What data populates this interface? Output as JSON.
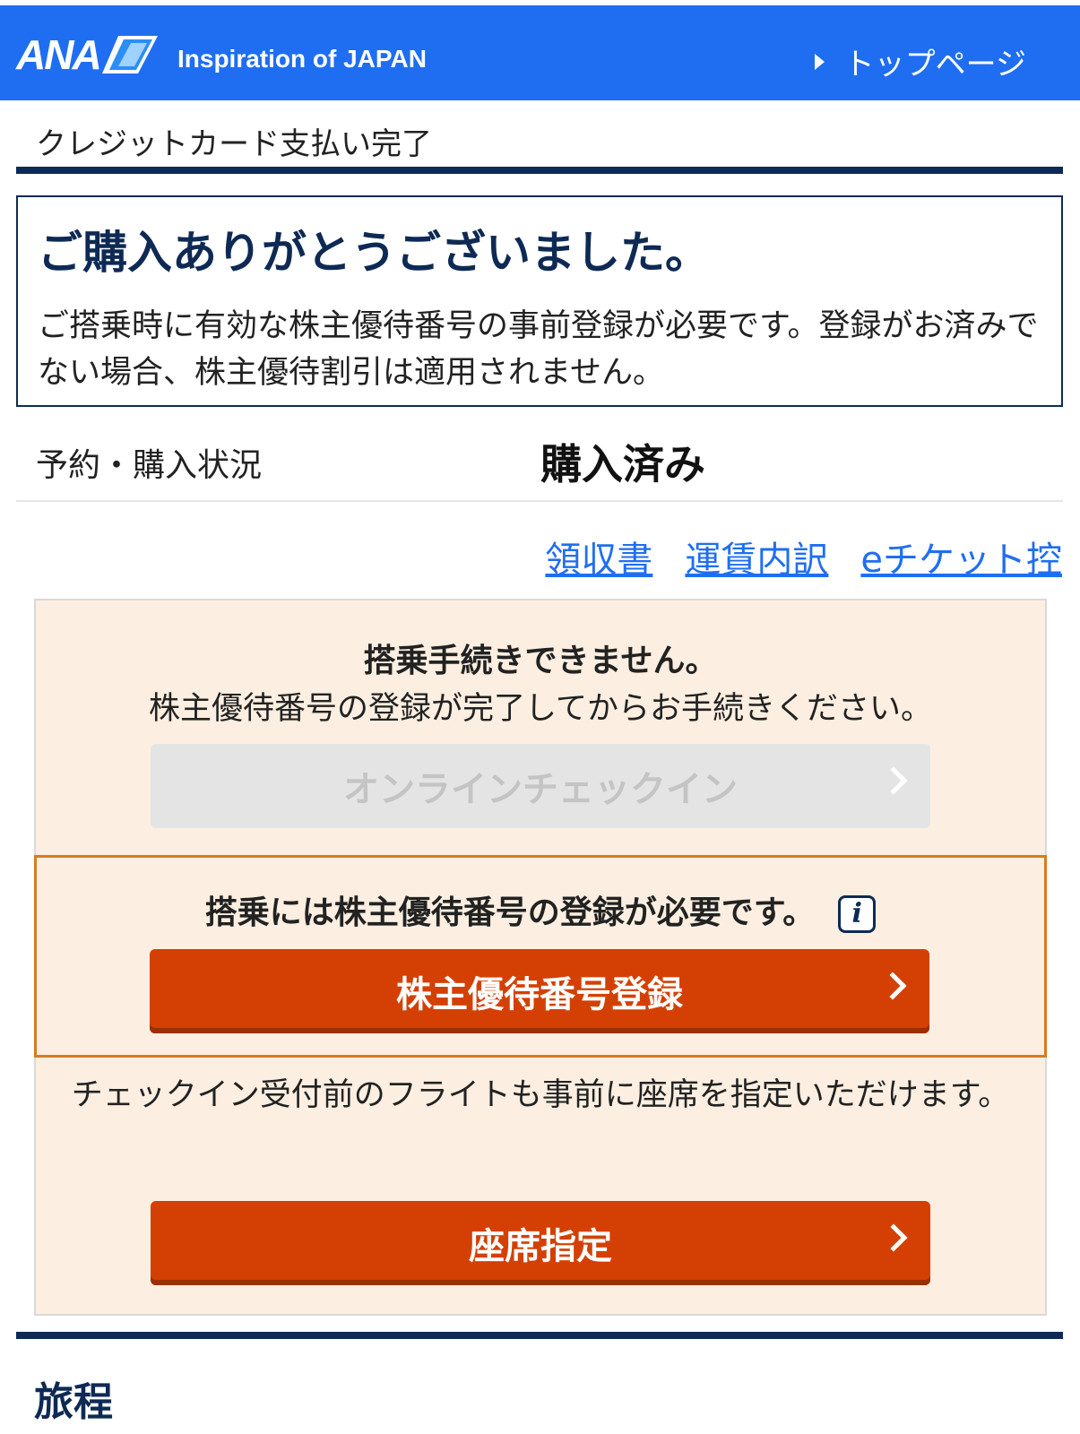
{
  "header": {
    "logo_text": "ANA",
    "tagline": "Inspiration of JAPAN",
    "top_link": "トップページ",
    "colors": {
      "bar": "#1f6ef2"
    }
  },
  "page_title": "クレジットカード支払い完了",
  "thanks": {
    "title": "ご購入ありがとうございました。",
    "message": "ご搭乗時に有効な株主優待番号の事前登録が必要です。登録がお済みでない場合、株主優待割引は適用されません。"
  },
  "status": {
    "label": "予約・購入状況",
    "value": "購入済み"
  },
  "links": {
    "receipt": "領収書",
    "fare_breakdown": "運賃内訳",
    "eticket": "eチケット控"
  },
  "checkin": {
    "title": "搭乗手続きできません。",
    "message": "株主優待番号の登録が完了してからお手続きください。",
    "button": "オンラインチェックイン"
  },
  "notice": {
    "text": "搭乗には株主優待番号の登録が必要です。",
    "info_icon": "i",
    "button": "株主優待番号登録"
  },
  "seat": {
    "message": "チェックイン受付前のフライトも事前に座席を指定いただけます。",
    "button": "座席指定"
  },
  "itinerary_title": "旅程",
  "colors": {
    "navy": "#0e2a54",
    "accent": "#d44004",
    "panel": "#fcefe1",
    "notice_border": "#d77b1f"
  }
}
